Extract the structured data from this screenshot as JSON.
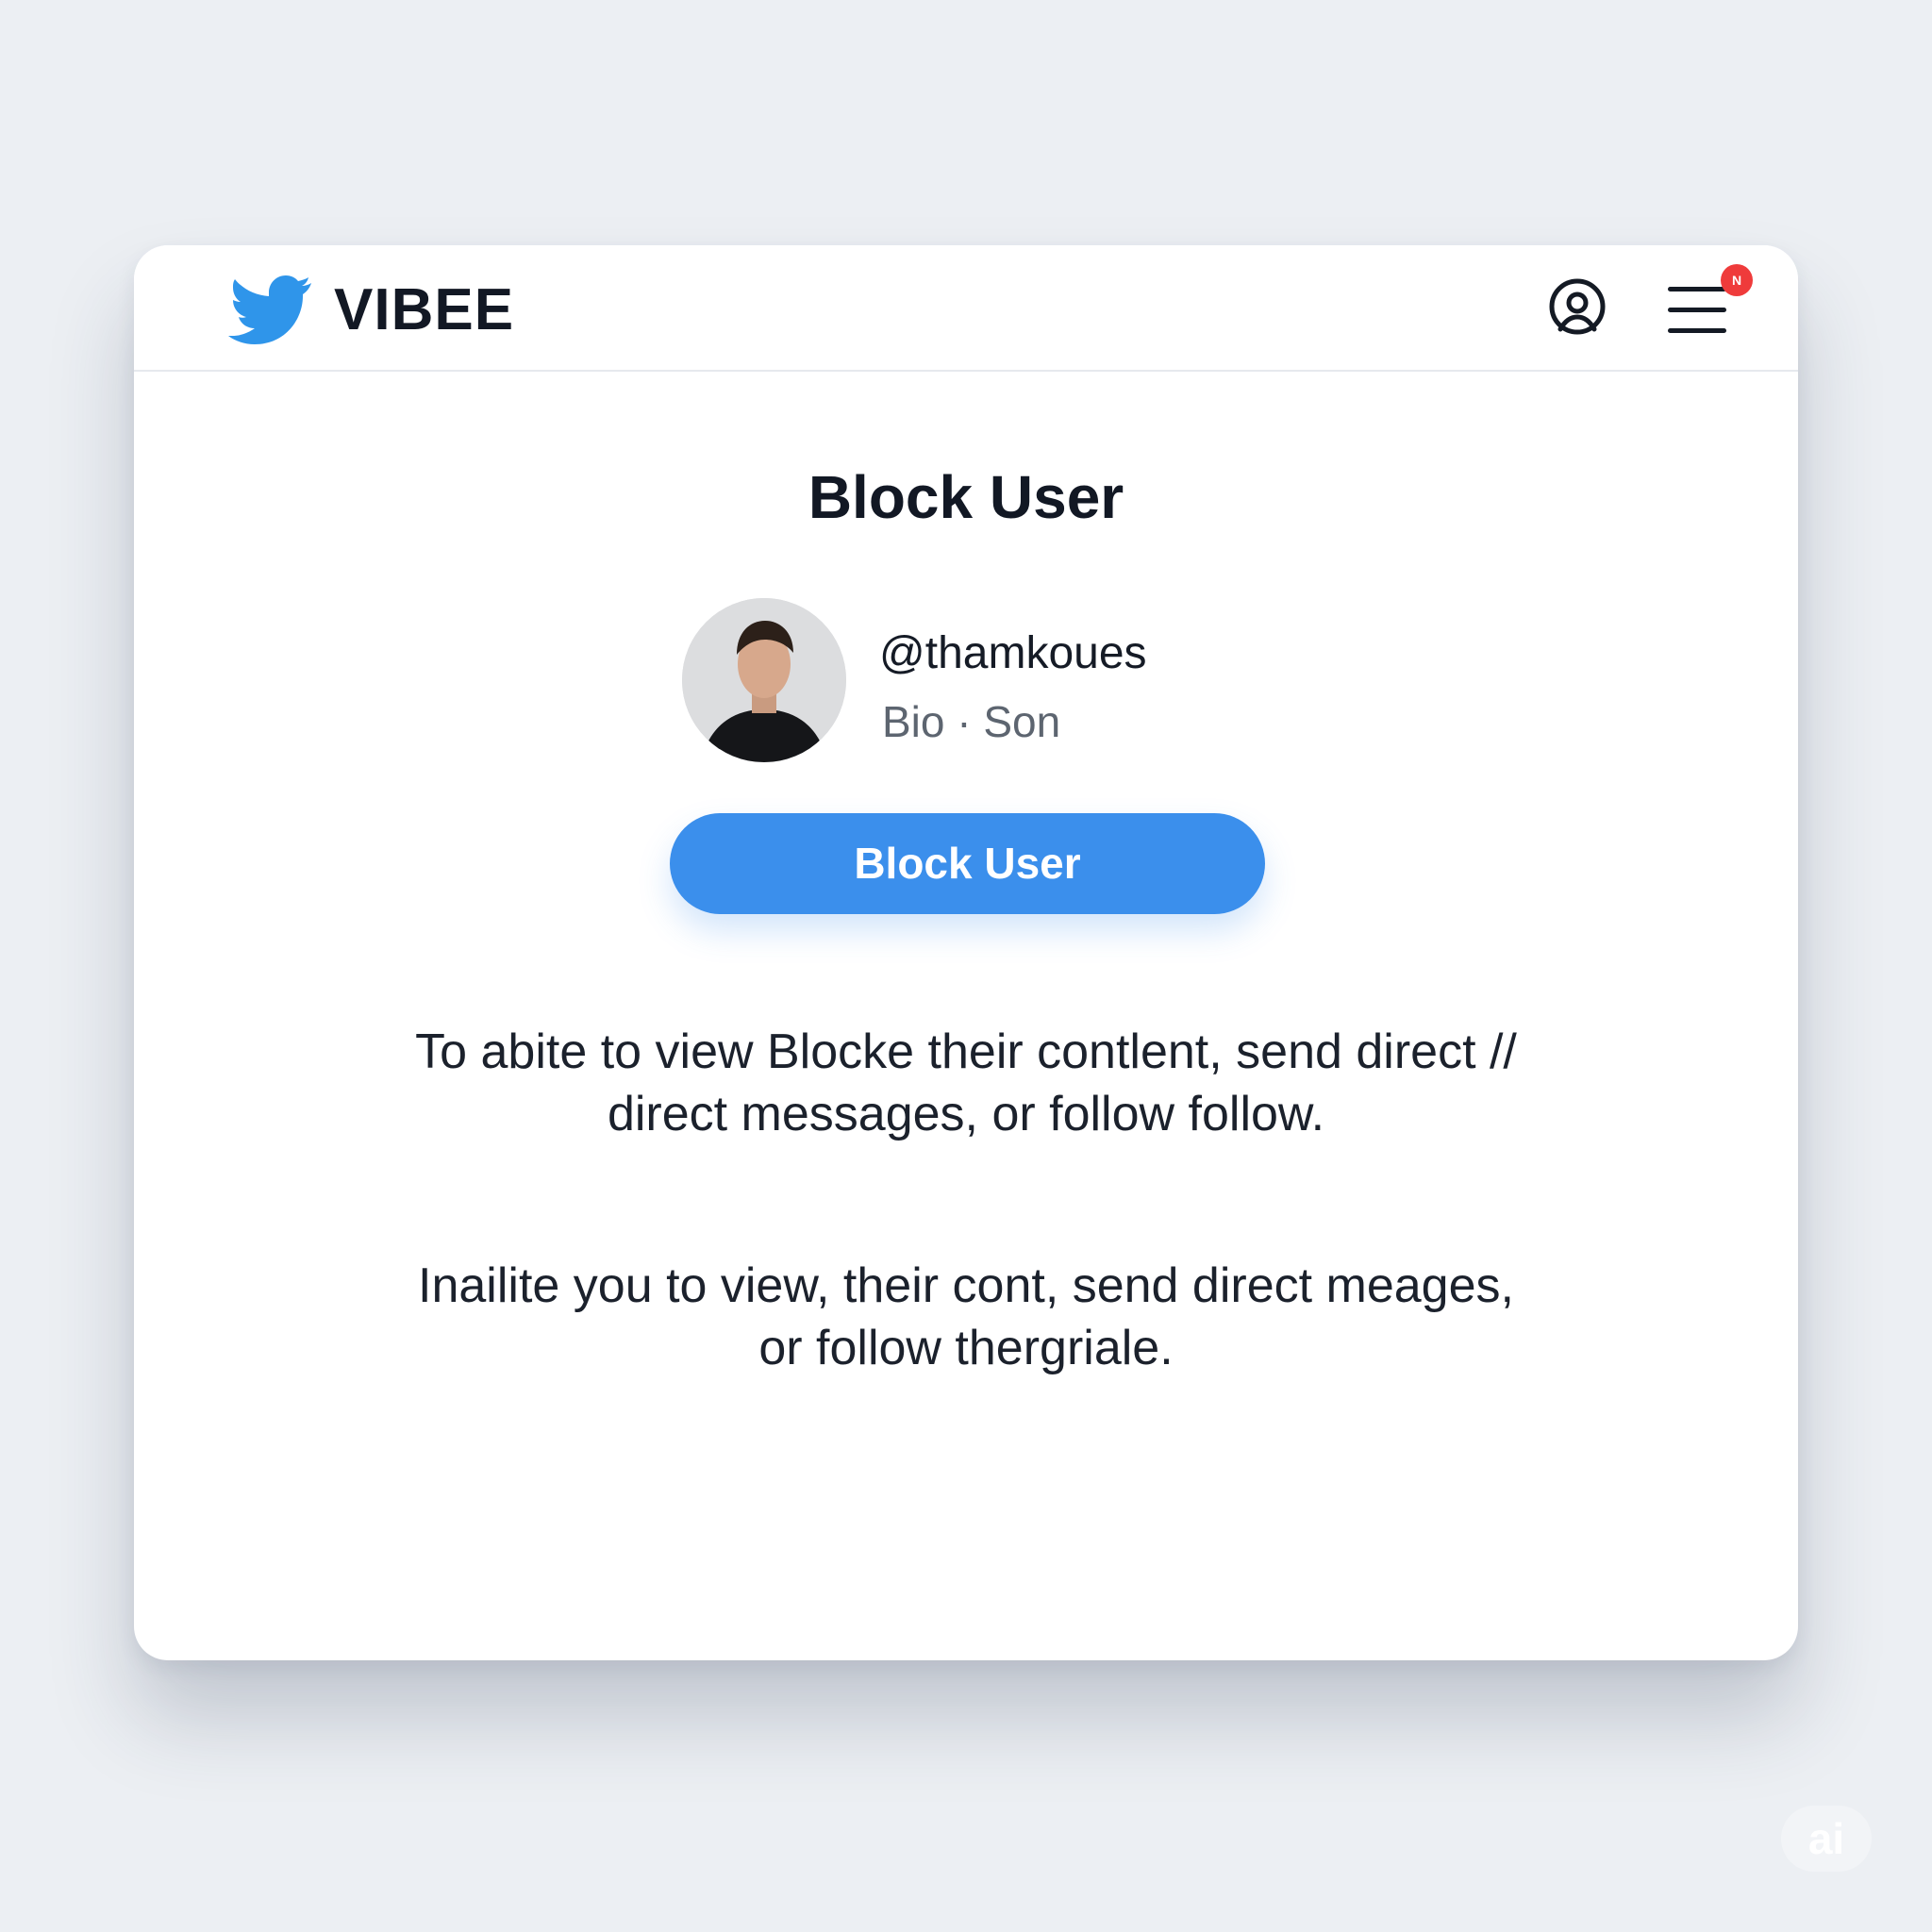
{
  "header": {
    "brand_name": "VIBEE",
    "brand_icon": "bird-logo-icon",
    "profile_icon": "profile-icon",
    "menu_icon": "hamburger-menu-icon",
    "notification_badge": "N"
  },
  "dialog": {
    "title": "Block User",
    "user": {
      "handle": "@thamkoues",
      "bio": "Bio · Son"
    },
    "block_button_label": "Block User",
    "description_1": "To abite to view Blocke their contlent, send direct // direct messages, or follow follow.",
    "description_2": "Inailite you to view, their cont, send direct meages, or follow thergriale."
  },
  "watermark": {
    "label": "ai"
  },
  "colors": {
    "accent": "#3b8fec",
    "brand_blue": "#2f95ea",
    "badge_red": "#ef3b3b",
    "background": "#eceff3"
  }
}
